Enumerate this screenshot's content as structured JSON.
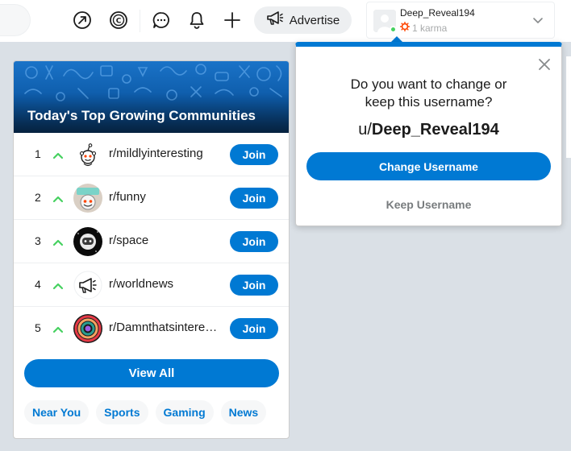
{
  "header": {
    "icons": [
      "popular-icon",
      "coins-icon",
      "chat-icon",
      "notification-icon",
      "create-post-icon"
    ],
    "advertise_label": "Advertise",
    "user": {
      "name": "Deep_Reveal194",
      "karma": "1 karma",
      "online": true
    }
  },
  "communities": {
    "title": "Today's Top Growing Communities",
    "items": [
      {
        "rank": "1",
        "name": "r/mildlyinteresting",
        "join_label": "Join",
        "icon": "snoo-icon"
      },
      {
        "rank": "2",
        "name": "r/funny",
        "join_label": "Join",
        "icon": "funny-snoo-icon"
      },
      {
        "rank": "3",
        "name": "r/space",
        "join_label": "Join",
        "icon": "space-snoo-icon"
      },
      {
        "rank": "4",
        "name": "r/worldnews",
        "join_label": "Join",
        "icon": "megaphone-icon"
      },
      {
        "rank": "5",
        "name": "r/Damnthatsinteresting",
        "join_label": "Join",
        "icon": "swirl-icon"
      }
    ],
    "view_all_label": "View All",
    "chips": [
      "Near You",
      "Sports",
      "Gaming",
      "News"
    ]
  },
  "popup": {
    "question": "Do you want to change or keep this username?",
    "username_prefix": "u/",
    "username": "Deep_Reveal194",
    "change_label": "Change Username",
    "keep_label": "Keep Username"
  },
  "colors": {
    "brand_blue": "#0079d3",
    "upvote_green": "#46d160",
    "page_bg": "#dae0e6",
    "karma_orange": "#ff4500"
  }
}
